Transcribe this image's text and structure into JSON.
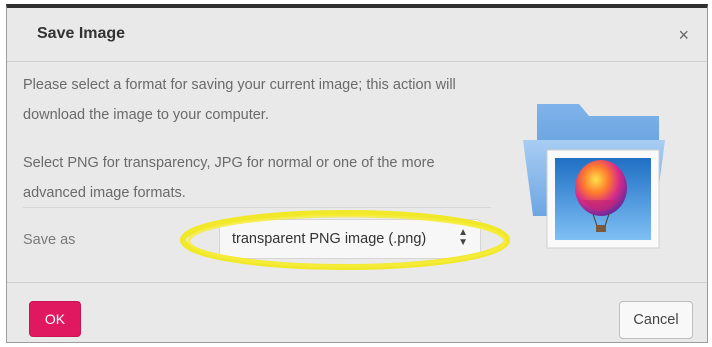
{
  "dialog": {
    "title": "Save Image",
    "close_glyph": "×",
    "paragraph1": "Please select a format for saving your current image; this action will download the image to your computer.",
    "paragraph2": "Select PNG for transparency, JPG for normal or one of the more advanced image formats.",
    "save_as_label": "Save as",
    "format_select": {
      "selected": "transparent PNG image (.png)",
      "arrows_icon": "updown-arrows-icon"
    },
    "image_icon": "folder-image-icon",
    "highlight_color": "#f2e82a"
  },
  "footer": {
    "ok_label": "OK",
    "cancel_label": "Cancel",
    "ok_color": "#e0185f"
  }
}
